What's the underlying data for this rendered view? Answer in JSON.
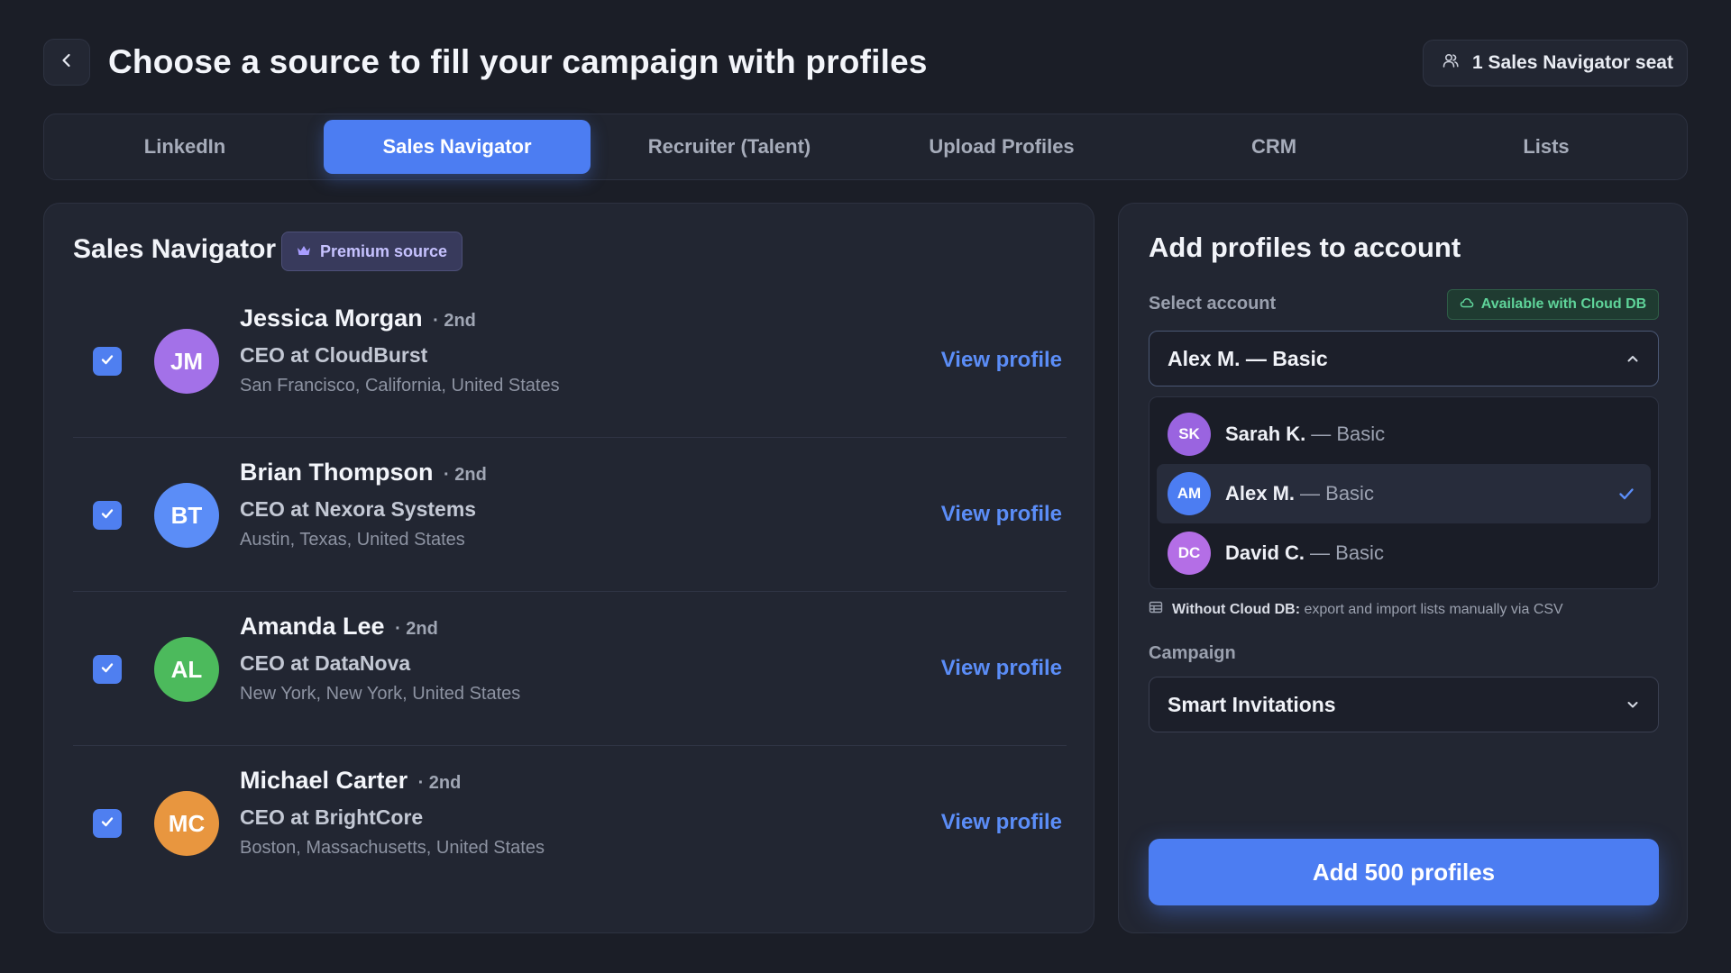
{
  "header": {
    "title": "Choose a source to fill your campaign with profiles",
    "seat_badge": "1 Sales Navigator seat"
  },
  "tabs": [
    {
      "label": "LinkedIn",
      "active": false
    },
    {
      "label": "Sales Navigator",
      "active": true
    },
    {
      "label": "Recruiter (Talent)",
      "active": false
    },
    {
      "label": "Upload Profiles",
      "active": false
    },
    {
      "label": "CRM",
      "active": false
    },
    {
      "label": "Lists",
      "active": false
    }
  ],
  "left_panel": {
    "title": "Sales Navigator",
    "badge": "Premium source",
    "profiles": [
      {
        "initials": "JM",
        "name": "Jessica Morgan",
        "degree": "· 2nd",
        "role": "CEO at CloudBurst",
        "location": "San Francisco, California, United States",
        "link": "View profile",
        "checked": true,
        "avatar_color": "#a371e8"
      },
      {
        "initials": "BT",
        "name": "Brian Thompson",
        "degree": "· 2nd",
        "role": "CEO at Nexora Systems",
        "location": "Austin, Texas, United States",
        "link": "View profile",
        "checked": true,
        "avatar_color": "#5b8df7"
      },
      {
        "initials": "AL",
        "name": "Amanda Lee",
        "degree": "· 2nd",
        "role": "CEO at DataNova",
        "location": "New York, New York, United States",
        "link": "View profile",
        "checked": true,
        "avatar_color": "#4cba5c"
      },
      {
        "initials": "MC",
        "name": "Michael Carter",
        "degree": "· 2nd",
        "role": "CEO at BrightCore",
        "location": "Boston, Massachusetts, United States",
        "link": "View profile",
        "checked": true,
        "avatar_color": "#e8963f"
      }
    ]
  },
  "right_panel": {
    "title": "Add profiles to account",
    "select_label": "Select account",
    "cloud_badge": "Available with Cloud DB",
    "selected_account": "Alex M. — Basic",
    "accounts": [
      {
        "initials": "SK",
        "name": "Sarah K.",
        "plan": "— Basic",
        "selected": false,
        "avatar_color": "#9a64e0"
      },
      {
        "initials": "AM",
        "name": "Alex M.",
        "plan": "— Basic",
        "selected": true,
        "avatar_color": "#4c7df2"
      },
      {
        "initials": "DC",
        "name": "David C.",
        "plan": "— Basic",
        "selected": false,
        "avatar_color": "#b46ee6"
      }
    ],
    "hint_bold": "Without Cloud DB:",
    "hint_text": "export and import lists manually via CSV",
    "campaign_label": "Campaign",
    "campaign_value": "Smart Invitations",
    "submit_label": "Add 500 profiles"
  },
  "colors": {
    "accent": "#4c7df2",
    "background": "#1b1e27",
    "panel": "#222632",
    "link": "#5b8df7",
    "success": "#5fd49a"
  }
}
